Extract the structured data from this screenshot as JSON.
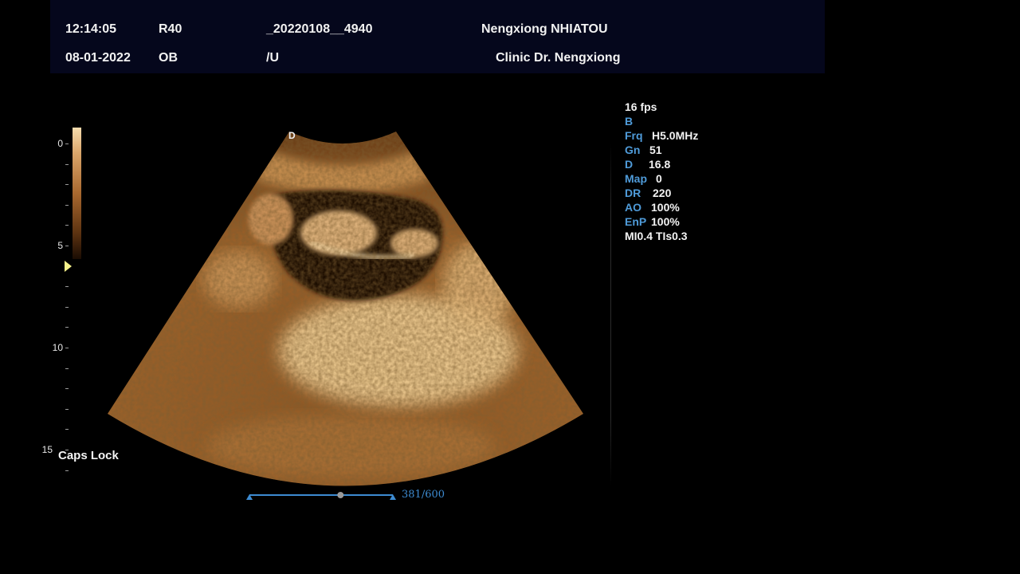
{
  "header": {
    "time": "12:14:05",
    "date": "08-01-2022",
    "probe": "R40",
    "exam": "OB",
    "patient_id": "_20220108__4940",
    "preset": "/U",
    "patient_name": "Nengxiong NHIATOU",
    "clinic": "Clinic Dr. Nengxiong"
  },
  "scale": {
    "labels": [
      "0",
      "5",
      "10",
      "15"
    ]
  },
  "params": {
    "fps": "16 fps",
    "mode": "B",
    "rows": [
      {
        "key": "Frq",
        "value": "H5.0MHz"
      },
      {
        "key": "Gn",
        "value": "51"
      },
      {
        "key": "D",
        "value": "16.8"
      },
      {
        "key": "Map",
        "value": "0"
      },
      {
        "key": "DR",
        "value": "220"
      },
      {
        "key": "AO",
        "value": "100%"
      },
      {
        "key": "EnP",
        "value": "100%"
      }
    ],
    "indices": "MI0.4 TIs0.3"
  },
  "overlay": {
    "caps_lock": "Caps Lock"
  },
  "cine": {
    "label": "381/600",
    "frame": 381,
    "total": 600
  },
  "colors": {
    "header_bg": "#05071c",
    "param_key": "#4f9bd9",
    "cine_blue": "#3d8bd1",
    "image_tint": "#c78a45"
  }
}
